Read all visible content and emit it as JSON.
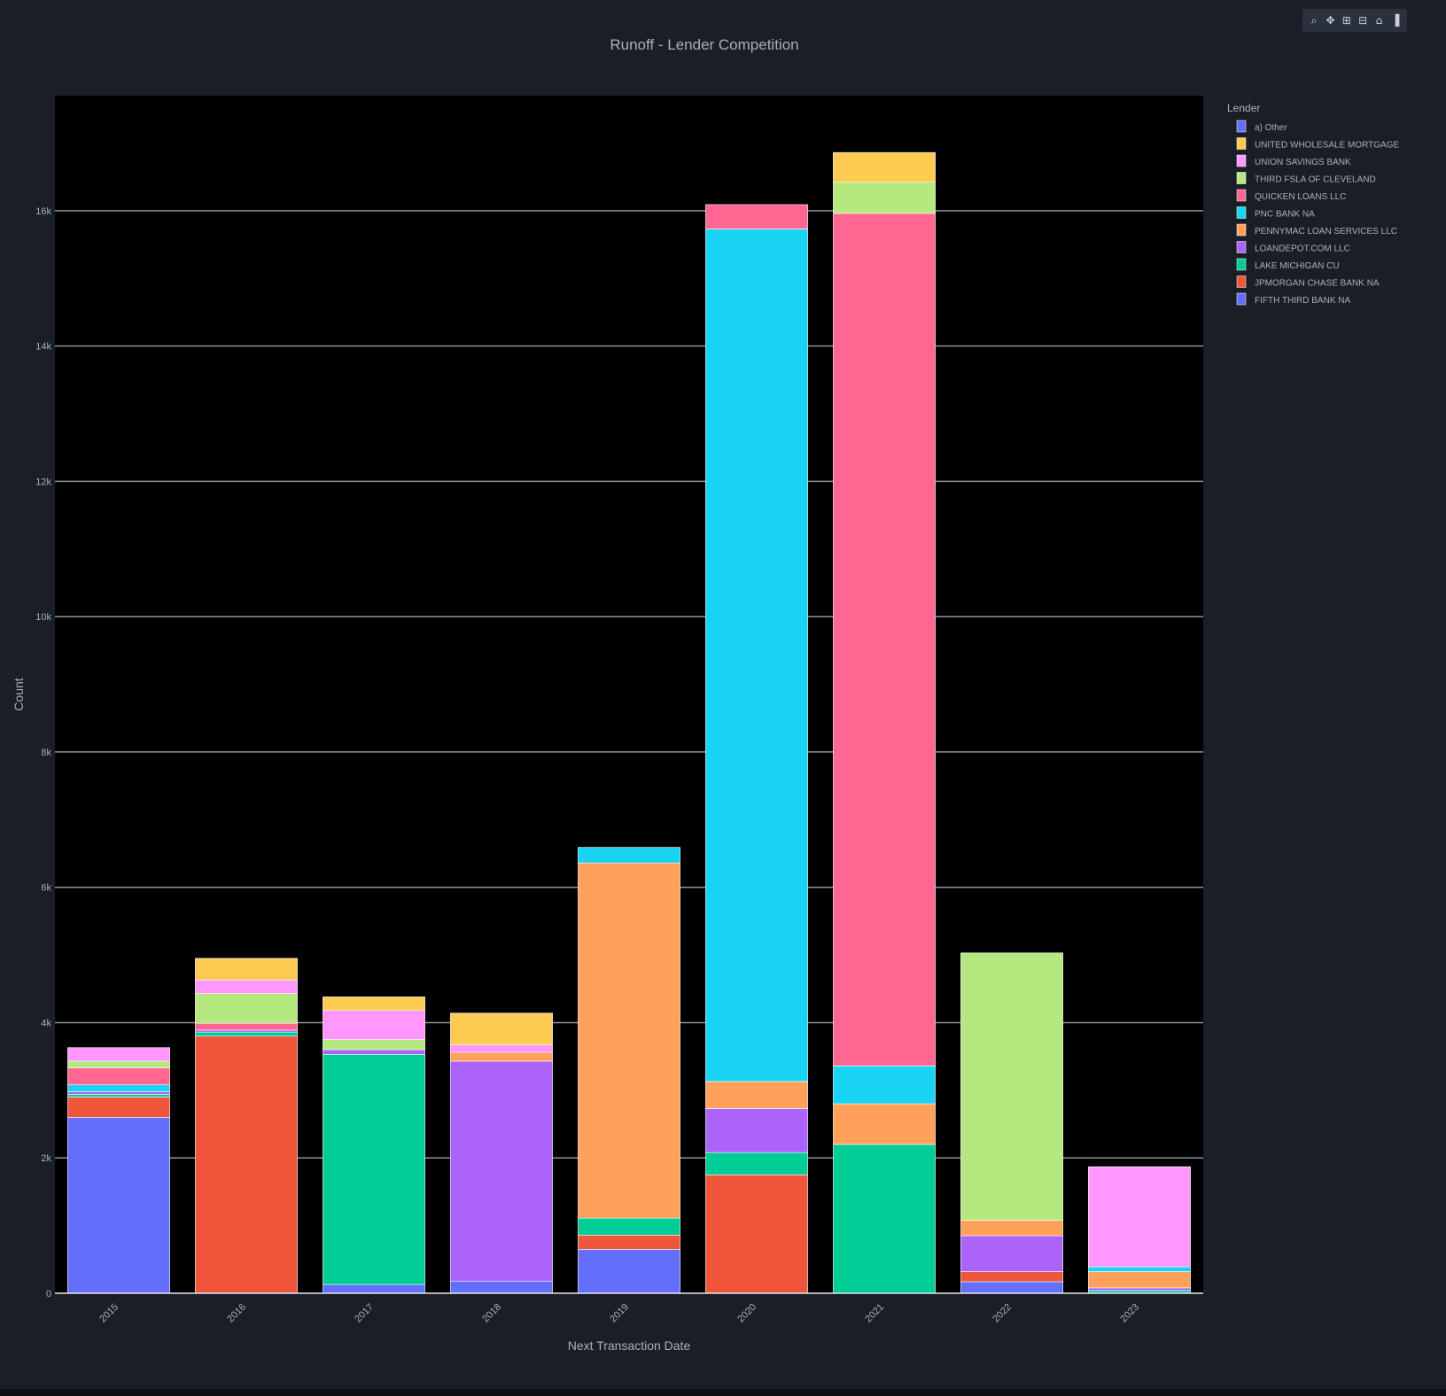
{
  "modebar": {
    "icons": [
      "zoom-icon",
      "pan-icon",
      "zoom-in-icon",
      "zoom-out-icon",
      "reset-axes-home-icon",
      "plotly-logo-icon"
    ],
    "glyphs": [
      "⌕",
      "✥",
      "⊞",
      "⊟",
      "⌂",
      "▐"
    ]
  },
  "colors": {
    "paper": "#1a1f27",
    "plot_bg": "#000000",
    "grid": "#8f949c",
    "text": "#a9b0bb"
  },
  "chart_data": {
    "type": "bar",
    "barmode": "stack",
    "title": "Runoff - Lender Competition",
    "xlabel": "Next Transaction Date",
    "ylabel": "Count",
    "legend_title": "Lender",
    "legend_position": "right",
    "grid": true,
    "ylim": [
      0,
      17700
    ],
    "yticks": [
      0,
      2000,
      4000,
      6000,
      8000,
      10000,
      12000,
      14000,
      16000
    ],
    "ytick_labels": [
      "0",
      "2k",
      "4k",
      "6k",
      "8k",
      "10k",
      "12k",
      "14k",
      "16k"
    ],
    "categories": [
      "2015",
      "2016",
      "2017",
      "2018",
      "2019",
      "2020",
      "2021",
      "2022",
      "2023"
    ],
    "series": [
      {
        "name": "FIFTH THIRD BANK NA",
        "color": "#636efa",
        "values": [
          2600,
          0,
          130,
          180,
          650,
          0,
          0,
          170,
          0
        ]
      },
      {
        "name": "JPMORGAN CHASE BANK NA",
        "color": "#ef553b",
        "values": [
          300,
          3800,
          0,
          0,
          210,
          1750,
          0,
          150,
          0
        ]
      },
      {
        "name": "LAKE MICHIGAN CU",
        "color": "#00cc96",
        "values": [
          40,
          60,
          3400,
          0,
          250,
          330,
          2200,
          0,
          40
        ]
      },
      {
        "name": "LOANDEPOT.COM LLC",
        "color": "#ab63fa",
        "values": [
          40,
          30,
          70,
          3250,
          0,
          650,
          0,
          530,
          40
        ]
      },
      {
        "name": "PENNYMAC LOAN SERVICES LLC",
        "color": "#ffa15a",
        "values": [
          0,
          0,
          0,
          130,
          5250,
          400,
          600,
          230,
          240
        ]
      },
      {
        "name": "PNC BANK NA",
        "color": "#19d3f3",
        "values": [
          100,
          0,
          0,
          0,
          230,
          12600,
          560,
          0,
          70
        ]
      },
      {
        "name": "QUICKEN LOANS LLC",
        "color": "#ff6692",
        "values": [
          250,
          100,
          0,
          0,
          0,
          360,
          12600,
          0,
          0
        ]
      },
      {
        "name": "THIRD FSLA OF CLEVELAND",
        "color": "#b6e880",
        "values": [
          100,
          440,
          150,
          0,
          0,
          0,
          460,
          3950,
          0
        ]
      },
      {
        "name": "UNION SAVINGS BANK",
        "color": "#ff97ff",
        "values": [
          200,
          200,
          430,
          110,
          0,
          0,
          0,
          0,
          1480
        ]
      },
      {
        "name": "UNITED WHOLESALE MORTGAGE",
        "color": "#fecb52",
        "values": [
          0,
          320,
          200,
          470,
          0,
          0,
          440,
          0,
          0
        ]
      },
      {
        "name": "a) Other",
        "color": "#636efa",
        "values": [
          0,
          0,
          0,
          0,
          0,
          0,
          0,
          0,
          0
        ]
      }
    ]
  }
}
